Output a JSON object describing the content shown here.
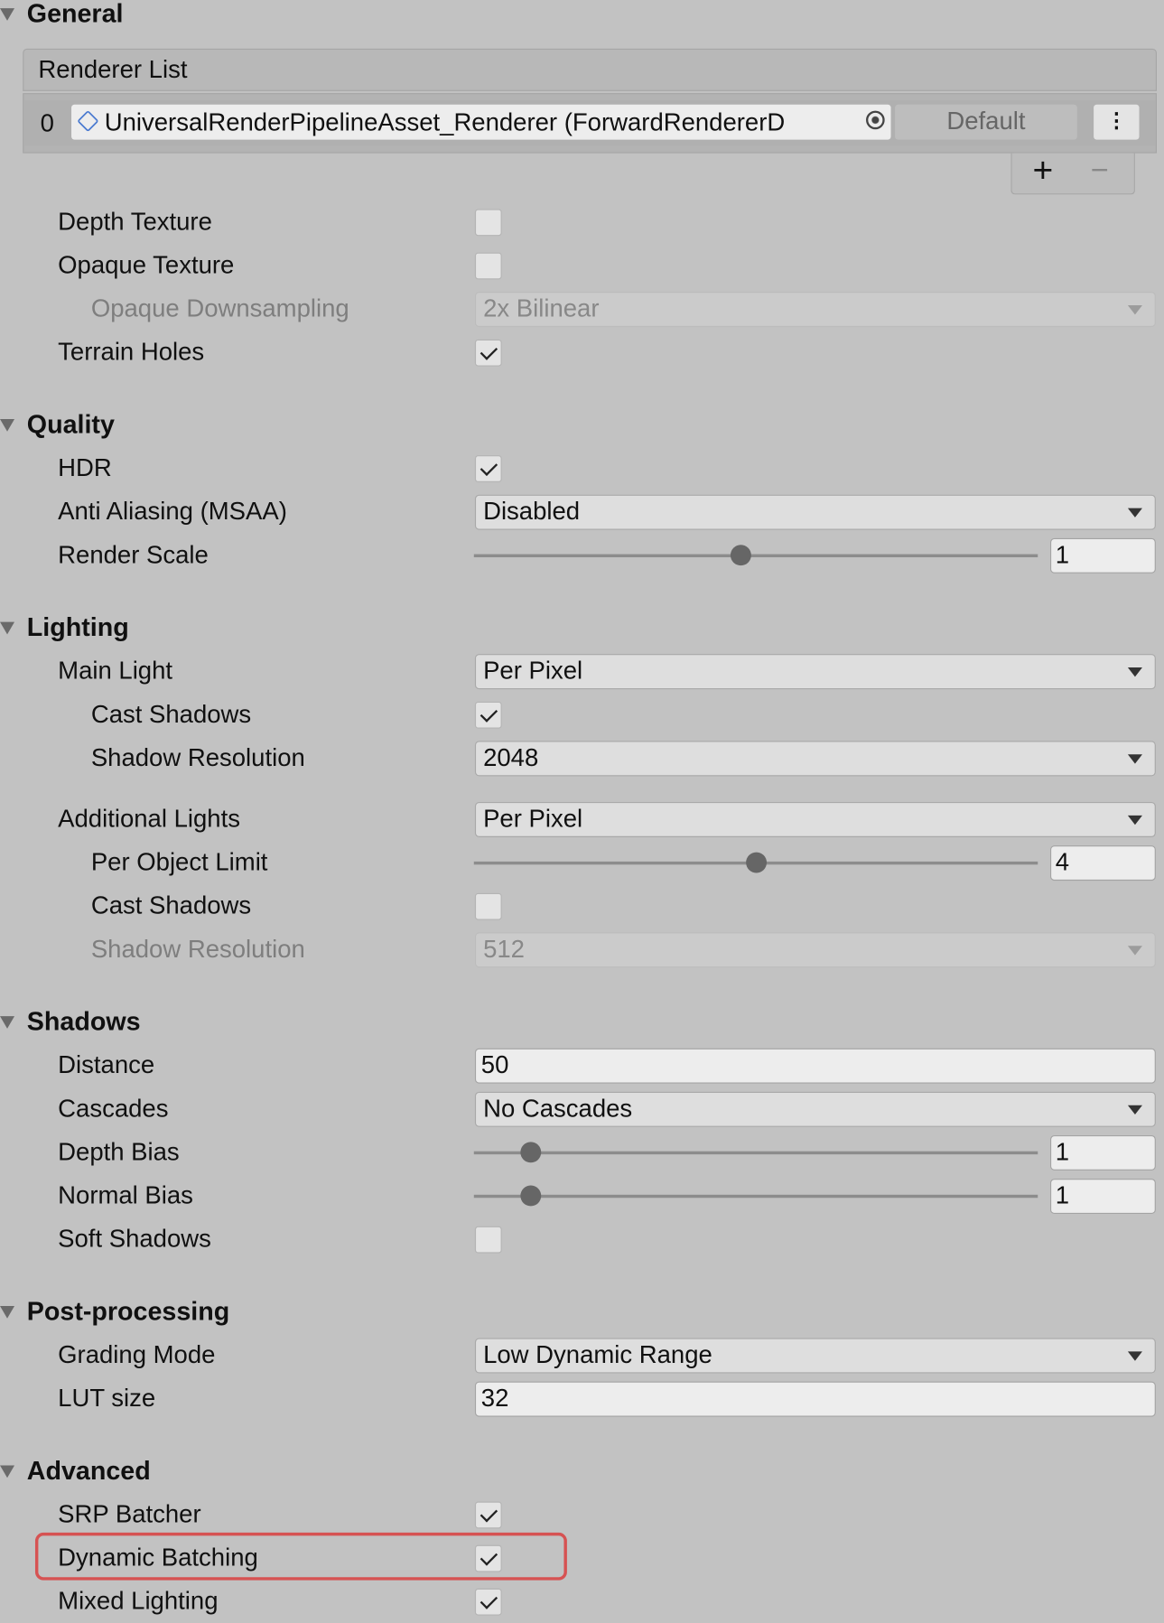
{
  "general": {
    "title": "General",
    "renderer_list": {
      "label": "Renderer List",
      "items": [
        {
          "index": "0",
          "name": "UniversalRenderPipelineAsset_Renderer (ForwardRendererD",
          "default_label": "Default"
        }
      ],
      "add_label": "+",
      "remove_label": "−",
      "menu_icon": "kebab-menu-icon",
      "asset_icon": "script-asset-icon",
      "picker_icon": "object-picker-icon"
    },
    "items": [
      {
        "label": "Depth Texture",
        "type": "checkbox",
        "checked": false
      },
      {
        "label": "Opaque Texture",
        "type": "checkbox",
        "checked": false
      },
      {
        "label": "Opaque Downsampling",
        "type": "dropdown",
        "value": "2x Bilinear",
        "disabled": true
      },
      {
        "label": "Terrain Holes",
        "type": "checkbox",
        "checked": true
      }
    ]
  },
  "quality": {
    "title": "Quality",
    "items": [
      {
        "label": "HDR",
        "type": "checkbox",
        "checked": true
      },
      {
        "label": "Anti Aliasing (MSAA)",
        "type": "dropdown",
        "value": "Disabled"
      },
      {
        "label": "Render Scale",
        "type": "slider",
        "value": "1",
        "min": 0.1,
        "max": 2
      }
    ]
  },
  "lighting": {
    "title": "Lighting",
    "items": [
      {
        "label": "Main Light",
        "type": "dropdown",
        "value": "Per Pixel"
      },
      {
        "label": "Cast Shadows",
        "type": "checkbox",
        "checked": true
      },
      {
        "label": "Shadow Resolution",
        "type": "dropdown",
        "value": "2048"
      },
      {
        "label": "Additional Lights",
        "type": "dropdown",
        "value": "Per Pixel"
      },
      {
        "label": "Per Object Limit",
        "type": "slider",
        "value": "4",
        "min": 0,
        "max": 8
      },
      {
        "label": "Cast Shadows",
        "type": "checkbox",
        "checked": false
      },
      {
        "label": "Shadow Resolution",
        "type": "dropdown",
        "value": "512",
        "disabled": true
      }
    ]
  },
  "shadows": {
    "title": "Shadows",
    "items": [
      {
        "label": "Distance",
        "type": "text",
        "value": "50"
      },
      {
        "label": "Cascades",
        "type": "dropdown",
        "value": "No Cascades"
      },
      {
        "label": "Depth Bias",
        "type": "slider",
        "value": "1",
        "min": 0,
        "max": 10
      },
      {
        "label": "Normal Bias",
        "type": "slider",
        "value": "1",
        "min": 0,
        "max": 10
      },
      {
        "label": "Soft Shadows",
        "type": "checkbox",
        "checked": false
      }
    ]
  },
  "post_processing": {
    "title": "Post-processing",
    "items": [
      {
        "label": "Grading Mode",
        "type": "dropdown",
        "value": "Low Dynamic Range"
      },
      {
        "label": "LUT size",
        "type": "text",
        "value": "32"
      }
    ]
  },
  "advanced": {
    "title": "Advanced",
    "items": [
      {
        "label": "SRP Batcher",
        "type": "checkbox",
        "checked": true
      },
      {
        "label": "Dynamic Batching",
        "type": "checkbox",
        "checked": true,
        "highlighted": true
      },
      {
        "label": "Mixed Lighting",
        "type": "checkbox",
        "checked": true
      }
    ]
  },
  "colors": {
    "background": "#c2c2c2",
    "highlight": "#d65252"
  }
}
